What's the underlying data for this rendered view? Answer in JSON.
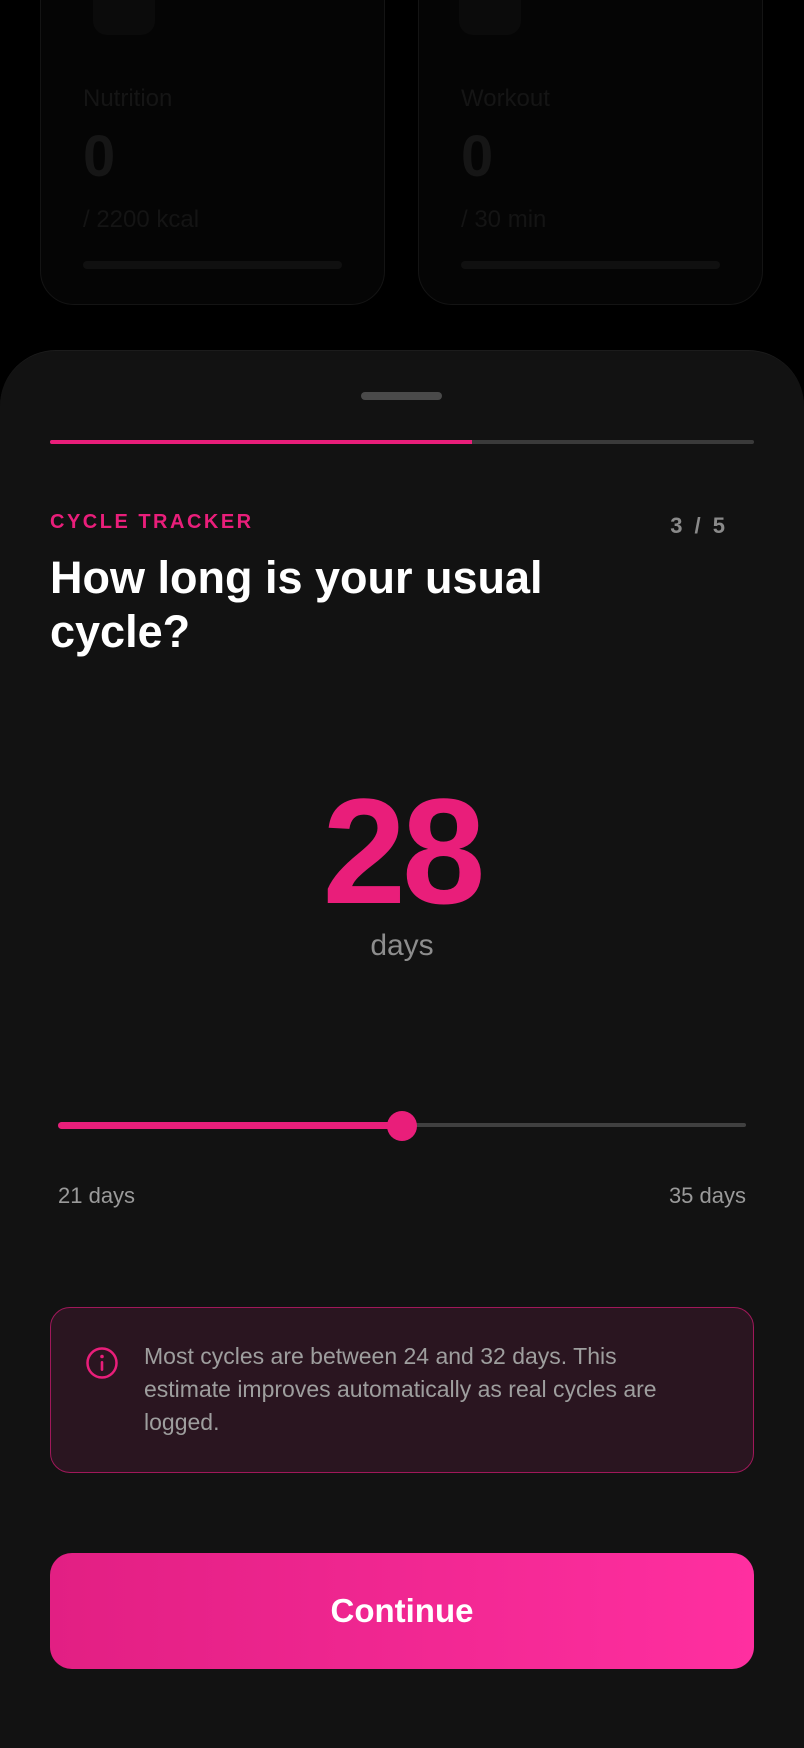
{
  "background_cards": [
    {
      "label": "Nutrition",
      "value": "0",
      "target": "/ 2200 kcal",
      "icon": "mug-icon"
    },
    {
      "label": "Workout",
      "value": "0",
      "target": "/ 30 min",
      "icon": "dumbbell-icon"
    }
  ],
  "sheet": {
    "progress": 0.6,
    "eyebrow": "CYCLE TRACKER",
    "step": "3 / 5",
    "question": "How long is your usual cycle?",
    "value": "28",
    "unit": "days",
    "slider": {
      "min": 21,
      "max": 35,
      "value": 28,
      "min_label": "21 days",
      "max_label": "35 days"
    },
    "info": {
      "icon": "info-icon",
      "text": "Most cycles are between 24 and 32 days. This estimate improves automatically as real cycles are logged."
    },
    "continue_label": "Continue"
  },
  "colors": {
    "accent": "#e91e7a",
    "sheet_background": "#121212",
    "info_background": "#2a1520"
  }
}
